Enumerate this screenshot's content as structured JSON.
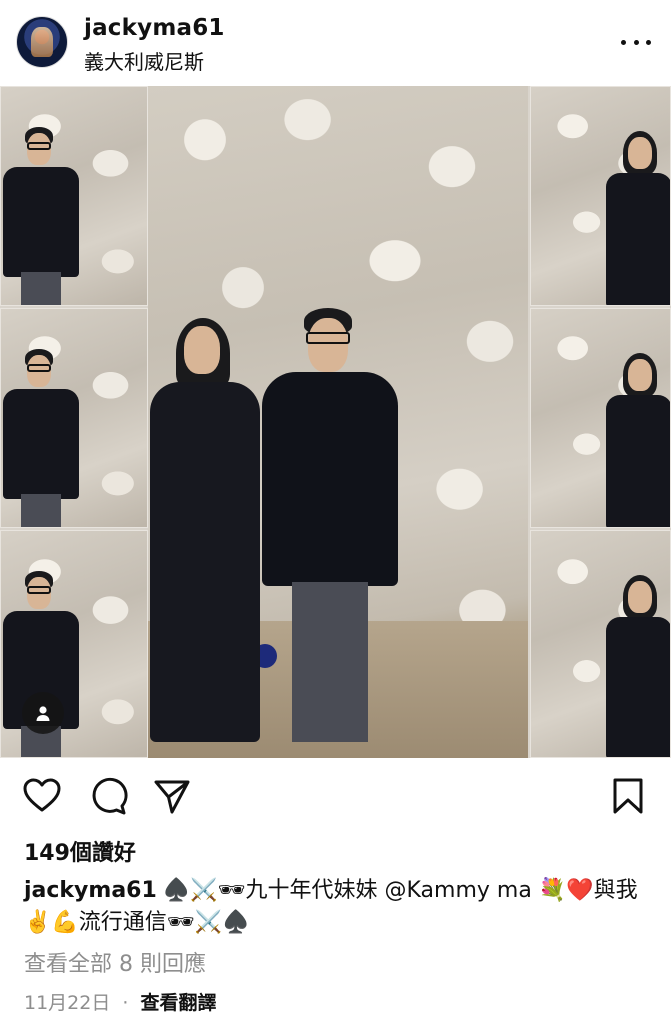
{
  "post": {
    "username": "jackyma61",
    "location": "義大利威尼斯"
  },
  "likes": "149個讚好",
  "caption": {
    "username": "jackyma61",
    "text": "♠️⚔️🕶九十年代妹妹 @Kammy ma 💐❤️與我✌️💪流行通信🕶⚔️♠️"
  },
  "view_comments": "查看全部 8 則回應",
  "date": "11月22日",
  "separator": "·",
  "translate": "查看翻譯",
  "icons": [
    "more-options-icon",
    "user-tag-icon",
    "heart-icon",
    "comment-icon",
    "share-icon",
    "bookmark-icon"
  ]
}
